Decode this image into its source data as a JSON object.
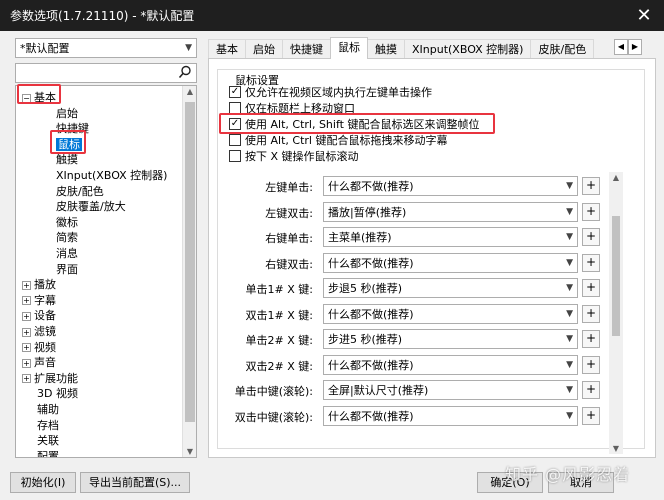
{
  "window": {
    "title": "参数选项(1.7.21110) - *默认配置",
    "close_glyph": "✕"
  },
  "left": {
    "preset": "*默认配置",
    "tree": [
      {
        "label": "基本",
        "exp": "−",
        "indent": 0
      },
      {
        "label": "启始",
        "indent": 2
      },
      {
        "label": "快捷键",
        "indent": 2
      },
      {
        "label": "鼠标",
        "indent": 2,
        "selected": true
      },
      {
        "label": "触摸",
        "indent": 2
      },
      {
        "label": "XInput(XBOX 控制器)",
        "indent": 2
      },
      {
        "label": "皮肤/配色",
        "indent": 2
      },
      {
        "label": "皮肤覆盖/放大",
        "indent": 2
      },
      {
        "label": "徽标",
        "indent": 2
      },
      {
        "label": "简索",
        "indent": 2
      },
      {
        "label": "消息",
        "indent": 2
      },
      {
        "label": "界面",
        "indent": 2
      },
      {
        "label": "播放",
        "exp": "+",
        "indent": 0
      },
      {
        "label": "字幕",
        "exp": "+",
        "indent": 0
      },
      {
        "label": "设备",
        "exp": "+",
        "indent": 0
      },
      {
        "label": "滤镜",
        "exp": "+",
        "indent": 0
      },
      {
        "label": "视频",
        "exp": "+",
        "indent": 0
      },
      {
        "label": "声音",
        "exp": "+",
        "indent": 0
      },
      {
        "label": "扩展功能",
        "exp": "+",
        "indent": 0
      },
      {
        "label": "3D 视频",
        "indent": 1
      },
      {
        "label": "辅助",
        "indent": 1
      },
      {
        "label": "存档",
        "indent": 1
      },
      {
        "label": "关联",
        "indent": 1
      },
      {
        "label": "配置",
        "indent": 1
      }
    ]
  },
  "tabs": [
    "基本",
    "启始",
    "快捷键",
    "鼠标",
    "触摸",
    "XInput(XBOX 控制器)",
    "皮肤/配色"
  ],
  "active_tab": "鼠标",
  "mouse": {
    "group_title": "鼠标设置",
    "options": [
      {
        "label": "仅允许在视频区域内执行左键单击操作",
        "checked": true
      },
      {
        "label": "仅在标题栏上移动窗口",
        "checked": false
      },
      {
        "label": "使用 Alt, Ctrl, Shift 键配合鼠标选区来调整帧位",
        "checked": true
      },
      {
        "label": "使用 Alt, Ctrl 键配合鼠标拖拽来移动字幕",
        "checked": false
      },
      {
        "label": "按下 X 键操作鼠标滚动",
        "checked": false
      }
    ],
    "bindings": [
      {
        "label": "左键单击:",
        "value": "什么都不做(推荐)"
      },
      {
        "label": "左键双击:",
        "value": "播放|暂停(推荐)"
      },
      {
        "label": "右键单击:",
        "value": "主菜单(推荐)"
      },
      {
        "label": "右键双击:",
        "value": "什么都不做(推荐)"
      },
      {
        "label": "单击1# X 键:",
        "value": "步退5 秒(推荐)"
      },
      {
        "label": "双击1# X 键:",
        "value": "什么都不做(推荐)"
      },
      {
        "label": "单击2# X 键:",
        "value": "步进5 秒(推荐)"
      },
      {
        "label": "双击2# X 键:",
        "value": "什么都不做(推荐)"
      },
      {
        "label": "单击中键(滚轮):",
        "value": "全屏|默认尺寸(推荐)"
      },
      {
        "label": "双击中键(滚轮):",
        "value": "什么都不做(推荐)"
      }
    ],
    "plus_label": "+"
  },
  "buttons": {
    "initialize": "初始化(I)",
    "export": "导出当前配置(S)...",
    "ok": "确定(O)",
    "cancel": "取消"
  },
  "watermark": "知乎 @风影忍着",
  "colors": {
    "highlight": "#e8343f",
    "selection": "#0078d7"
  }
}
